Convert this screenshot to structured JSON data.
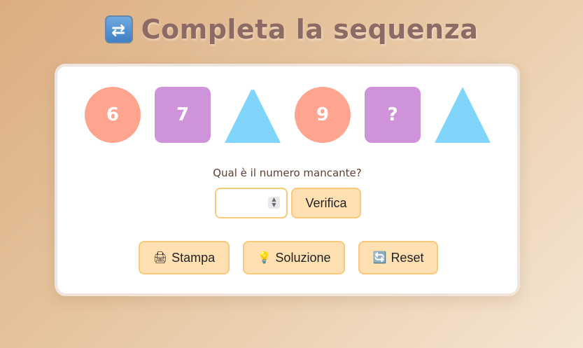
{
  "header": {
    "icon": "repeat-icon",
    "title": "Completa la sequenza"
  },
  "sequence": [
    {
      "shape": "circle",
      "label": "6",
      "color": "#ffa48e"
    },
    {
      "shape": "square",
      "label": "7",
      "color": "#ce93d8"
    },
    {
      "shape": "triangle",
      "label": "",
      "color": "#81d4fa"
    },
    {
      "shape": "circle",
      "label": "9",
      "color": "#ffa48e"
    },
    {
      "shape": "square",
      "label": "?",
      "color": "#ce93d8"
    },
    {
      "shape": "triangle",
      "label": "",
      "color": "#81d4fa"
    }
  ],
  "question": {
    "text": "Qual è il numero mancante?"
  },
  "answer": {
    "value": "",
    "placeholder": ""
  },
  "buttons": {
    "verify": "Verifica",
    "print": "Stampa",
    "solution": "Soluzione",
    "reset": "Reset"
  },
  "icons": {
    "print": "printer-icon",
    "solution": "lightbulb-icon",
    "reset": "refresh-icon"
  },
  "colors": {
    "accent": "#ffe0b2",
    "accent_border": "#f7c97a",
    "title": "#8d6a63"
  }
}
